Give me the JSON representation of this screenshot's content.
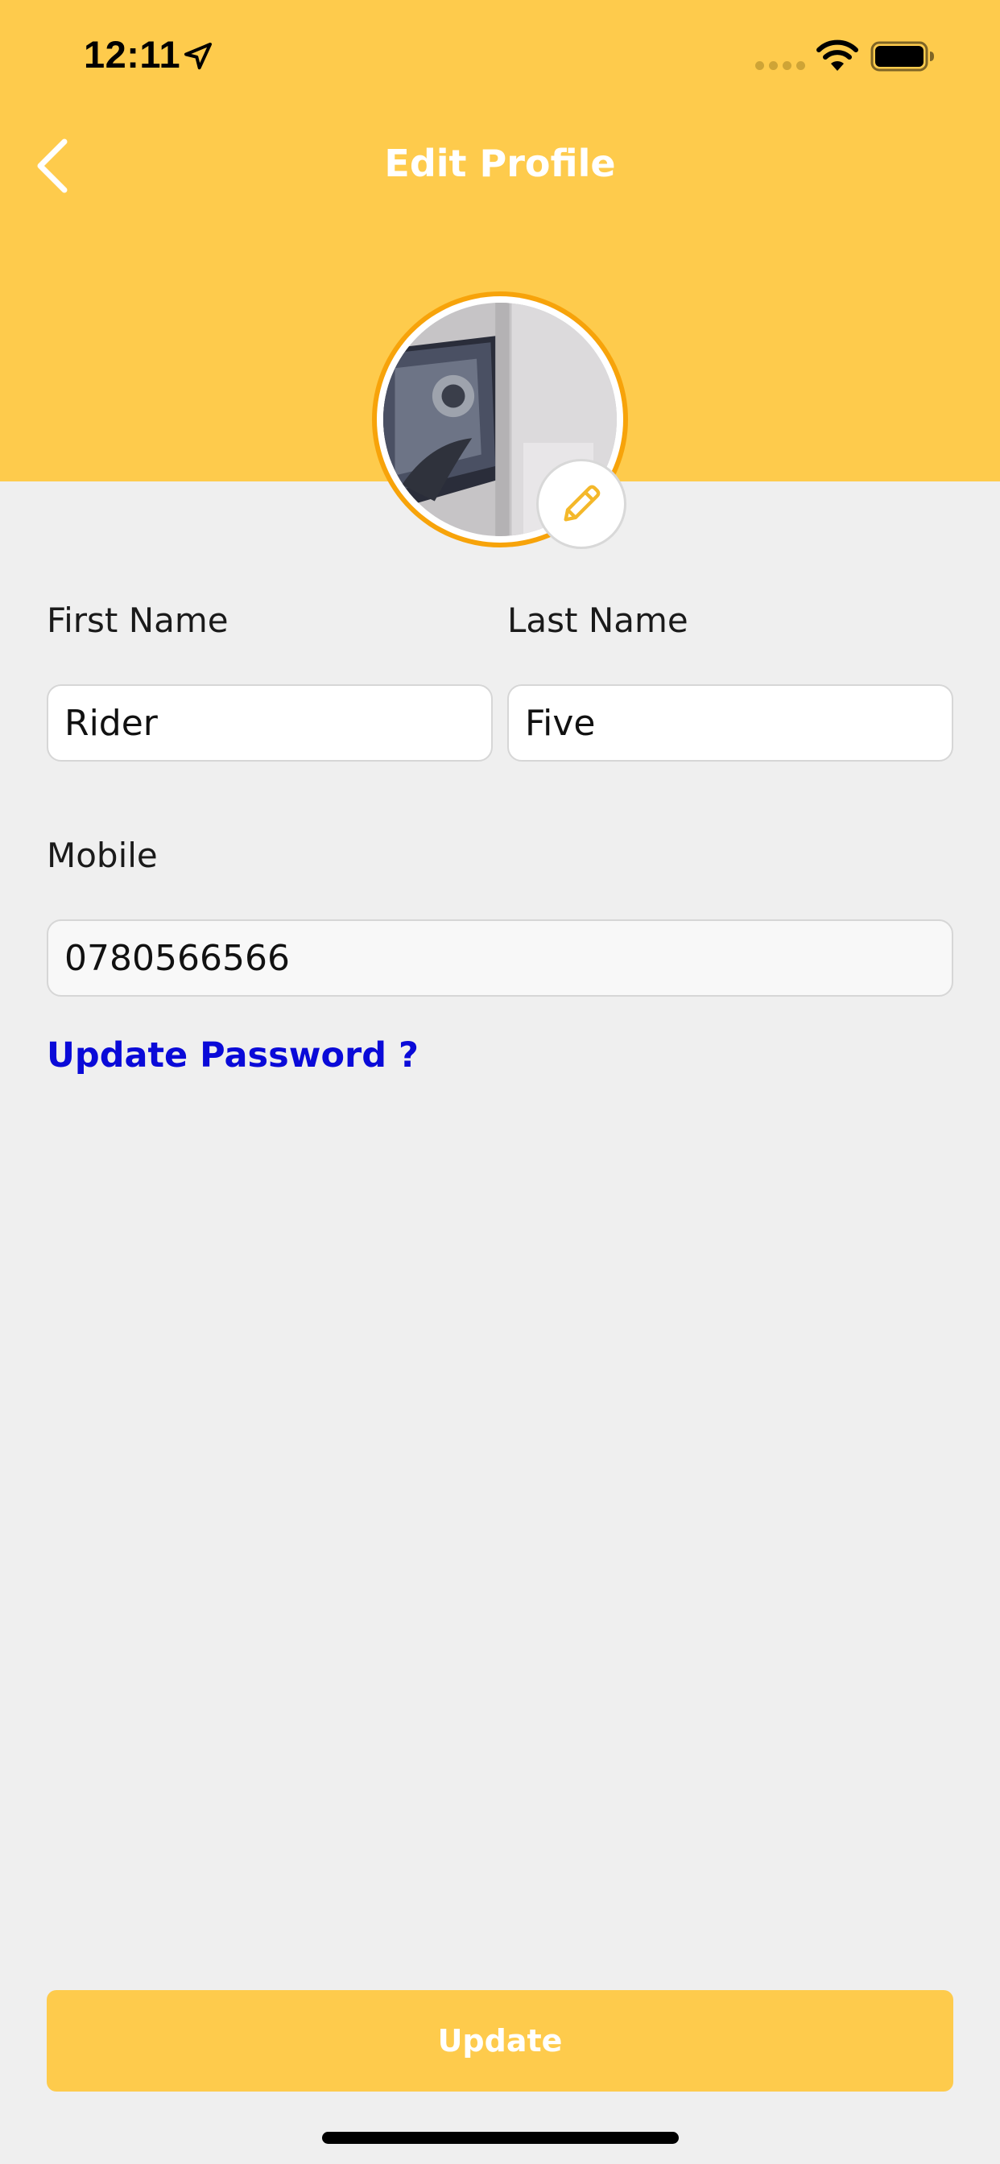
{
  "status_bar": {
    "time": "12:11",
    "location_icon": "location-arrow-icon",
    "wifi_icon": "wifi-icon",
    "battery_icon": "battery-icon"
  },
  "header": {
    "title": "Edit Profile",
    "back_icon": "chevron-left-icon"
  },
  "avatar": {
    "edit_icon": "pencil-icon"
  },
  "form": {
    "first_name": {
      "label": "First Name",
      "value": "Rider"
    },
    "last_name": {
      "label": "Last Name",
      "value": "Five"
    },
    "mobile": {
      "label": "Mobile",
      "value": "0780566566"
    },
    "update_password_link": "Update Password ?"
  },
  "footer": {
    "update_label": "Update"
  },
  "colors": {
    "header_bg": "#fecb4c",
    "avatar_ring": "#f7a30a",
    "link": "#0a0ad8",
    "page_bg": "#efefef"
  }
}
